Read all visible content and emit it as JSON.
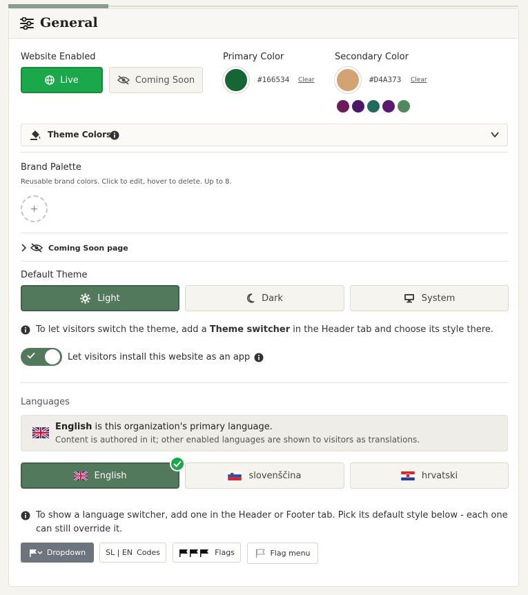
{
  "header": {
    "title": "General",
    "icon": "sliders-icon"
  },
  "website": {
    "label": "Website Enabled",
    "live_label": "Live",
    "coming_soon_label": "Coming Soon",
    "selected": "Live"
  },
  "primary_color": {
    "label": "Primary Color",
    "value": "#166534",
    "clear_label": "Clear"
  },
  "secondary_color": {
    "label": "Secondary Color",
    "value": "#D4A373",
    "clear_label": "Clear"
  },
  "preset_dots": [
    "#6b1d5a",
    "#4b1768",
    "#1f6b5e",
    "#5a1a70",
    "#4f8a5e"
  ],
  "theme_colors": {
    "label": "Theme Colors"
  },
  "brand_palette": {
    "label": "Brand Palette",
    "hint": "Reusable brand colors. Click to edit, hover to delete. Up to 8.",
    "add_symbol": "+"
  },
  "coming_soon_page": {
    "label": "Coming Soon page"
  },
  "default_theme": {
    "label": "Default Theme",
    "options": [
      "Light",
      "Dark",
      "System"
    ],
    "selected": "Light",
    "info_before": "To let visitors switch the theme, add a ",
    "info_bold": "Theme switcher",
    "info_after": " in the Header tab and choose its style there."
  },
  "install_app": {
    "label": "Let visitors install this website as an app",
    "enabled": true
  },
  "languages": {
    "label": "Languages",
    "notice_bold": "English",
    "notice_rest": " is this organization's primary language.",
    "notice_sub": "Content is authored in it; other enabled languages are shown to visitors as translations.",
    "options": [
      "English",
      "slovenščina",
      "hrvatski"
    ],
    "selected": "English",
    "switcher_info": "To show a language switcher, add one in the Header or Footer tab. Pick its default style below - each one can still override it."
  },
  "switcher_styles": {
    "dropdown": "Dropdown",
    "codes_prefix": "SL | EN",
    "codes": "Codes",
    "flags": "Flags",
    "flag_menu": "Flag menu",
    "selected": "Dropdown"
  },
  "colors": {
    "accent_green": "#1aa84a",
    "selected_sage": "#52795c",
    "panel_bg": "#f6f4ee"
  }
}
